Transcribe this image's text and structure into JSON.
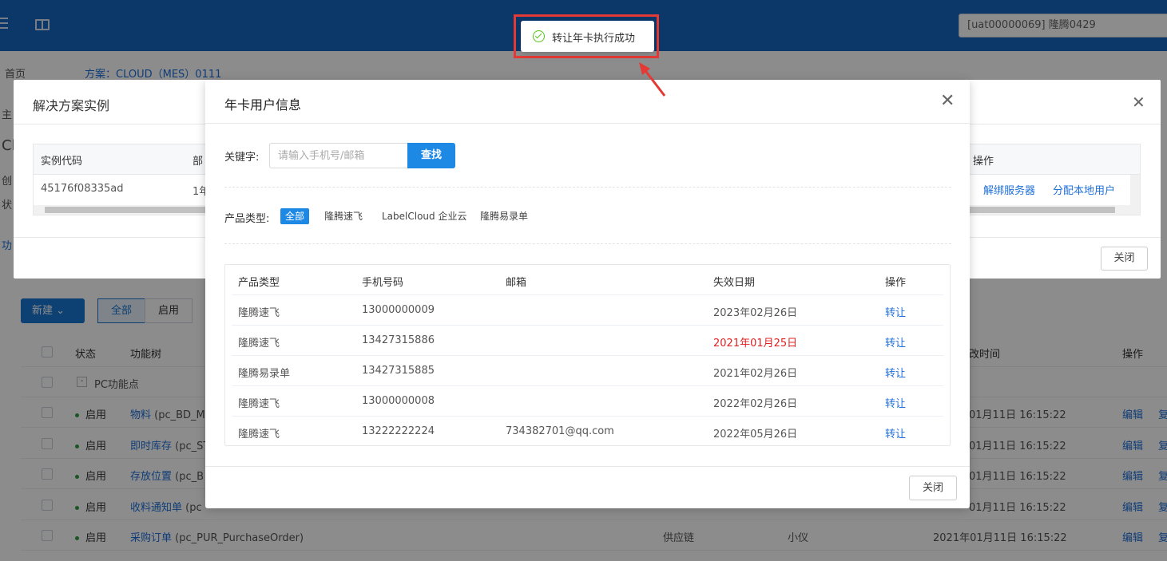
{
  "topbar": {
    "tenant": "[uat00000069] 隆腾0429"
  },
  "breadcrumb": {
    "home": "首页",
    "plan": "方案：CLOUD（MES）0111"
  },
  "background": {
    "left_letters": [
      "主",
      "Cl",
      "创",
      "状",
      "功"
    ],
    "new_button": "新建",
    "filter_tabs": [
      "全部",
      "启用"
    ],
    "table_header": {
      "status": "状态",
      "func_tree": "功能树",
      "time": "改时间",
      "ops": "操作"
    },
    "group_row": "PC功能点",
    "rows": [
      {
        "status": "启用",
        "name": "物料",
        "code": "(pc_BD_M",
        "c3": "",
        "c4": "",
        "time": "01月11日 16:15:22",
        "edit": "编辑",
        "more": "复"
      },
      {
        "status": "启用",
        "name": "即时库存",
        "code": "(pc_ST",
        "c3": "",
        "c4": "",
        "time": "01月11日 16:15:22",
        "edit": "编辑",
        "more": "复"
      },
      {
        "status": "启用",
        "name": "存放位置",
        "code": "(pc_B",
        "c3": "",
        "c4": "",
        "time": "01月11日 16:15:22",
        "edit": "编辑",
        "more": "复"
      },
      {
        "status": "启用",
        "name": "收料通知单",
        "code": "(pc",
        "c3": "",
        "c4": "",
        "time": "01月11日 16:15:22",
        "edit": "编辑",
        "more": "复"
      },
      {
        "status": "启用",
        "name": "采购订单",
        "code": "(pc_PUR_PurchaseOrder)",
        "c3": "供应链",
        "c4": "小仪",
        "time": "2021年01月11日 16:15:22",
        "edit": "编辑",
        "more": "复"
      }
    ]
  },
  "solution_dialog": {
    "title": "解决方案实例",
    "columns": [
      "实例代码",
      "部",
      "操作"
    ],
    "row": [
      "45176f08335ad",
      "1年"
    ],
    "actions": [
      "解绑服务器",
      "分配本地用户"
    ],
    "close_button": "关闭"
  },
  "dialog": {
    "title": "年卡用户信息",
    "keyword_label": "关键字:",
    "keyword_placeholder": "请输入手机号/邮箱",
    "search_button": "查找",
    "type_label": "产品类型:",
    "types": [
      "全部",
      "隆腾速飞",
      "LabelCloud 企业云",
      "隆腾易录单"
    ],
    "active_type": "全部",
    "columns": [
      "产品类型",
      "手机号码",
      "邮箱",
      "失效日期",
      "操作"
    ],
    "rows": [
      {
        "type": "隆腾速飞",
        "phone": "13000000009",
        "email": "",
        "expire": "2023年02月26日",
        "expired": false,
        "op": "转让"
      },
      {
        "type": "隆腾速飞",
        "phone": "13427315886",
        "email": "",
        "expire": "2021年01月25日",
        "expired": true,
        "op": "转让"
      },
      {
        "type": "隆腾易录单",
        "phone": "13427315885",
        "email": "",
        "expire": "2021年02月26日",
        "expired": false,
        "op": "转让"
      },
      {
        "type": "隆腾速飞",
        "phone": "13000000008",
        "email": "",
        "expire": "2022年02月26日",
        "expired": false,
        "op": "转让"
      },
      {
        "type": "隆腾速飞",
        "phone": "13222222224",
        "email": "734382701@qq.com",
        "expire": "2022年05月26日",
        "expired": false,
        "op": "转让"
      }
    ],
    "close_button": "关闭"
  },
  "toast": {
    "message": "转让年卡执行成功"
  },
  "colors": {
    "topbar": "#1565c0",
    "primary": "#1e88e5",
    "link": "#1e6fd9",
    "expired": "#e02020",
    "highlight_frame": "#e53935",
    "success": "#52c41a"
  }
}
